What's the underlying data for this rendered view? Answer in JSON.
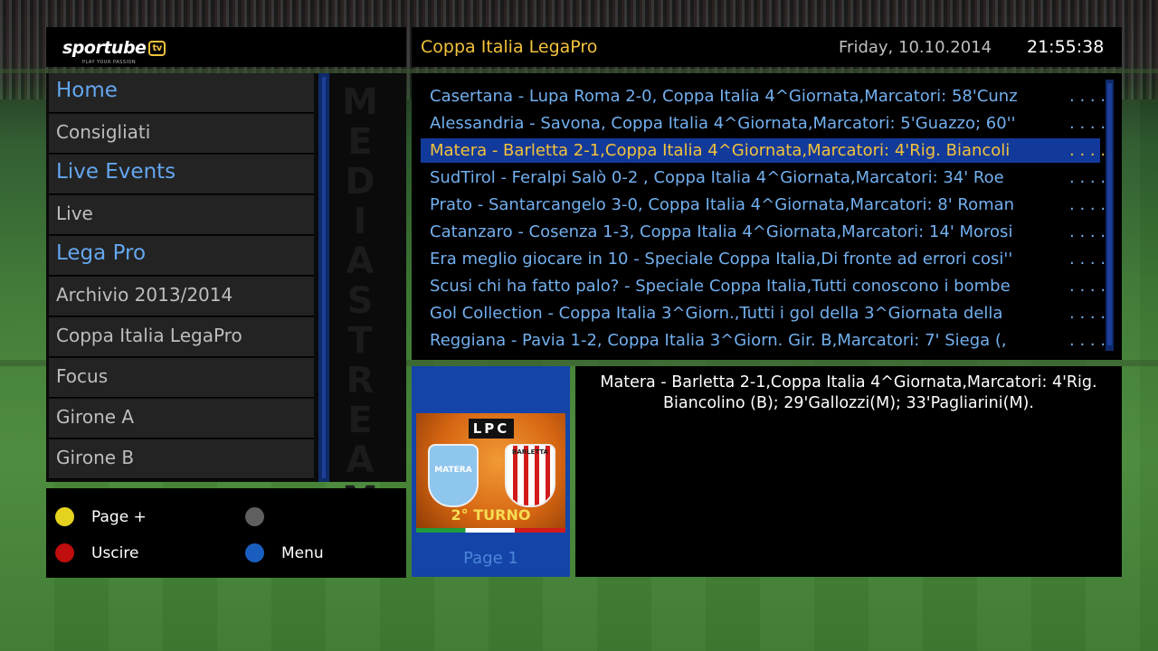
{
  "logo": {
    "brand": "sportube",
    "tv": "tv",
    "tagline": "PLAY YOUR PASSION"
  },
  "header": {
    "title": "Coppa Italia LegaPro",
    "date": "Friday, 10.10.2014",
    "time": "21:55:38"
  },
  "menu": {
    "items": [
      {
        "label": "Home",
        "category": true
      },
      {
        "label": "Consigliati",
        "category": false
      },
      {
        "label": "Live Events",
        "category": true
      },
      {
        "label": "Live",
        "category": false
      },
      {
        "label": "Lega Pro",
        "category": true
      },
      {
        "label": "Archivio 2013/2014",
        "category": false
      },
      {
        "label": "Coppa Italia LegaPro",
        "category": false
      },
      {
        "label": "Focus",
        "category": false
      },
      {
        "label": "Girone A",
        "category": false
      },
      {
        "label": "Girone B",
        "category": false
      }
    ],
    "vertical_text": "MEDIASTREAM"
  },
  "buttons": {
    "yellow": {
      "label": "Page +",
      "color": "#e4d21f"
    },
    "gray": {
      "label": "",
      "color": "#5f5f5f"
    },
    "red": {
      "label": "Uscire",
      "color": "#c00d0d"
    },
    "blue": {
      "label": "Menu",
      "color": "#1a5fbf"
    }
  },
  "list": {
    "selected_index": 2,
    "more": ". . . .",
    "rows": [
      "Casertana - Lupa Roma 2-0, Coppa Italia 4^Giornata,Marcatori: 58'Cunz",
      "Alessandria - Savona, Coppa Italia 4^Giornata,Marcatori: 5'Guazzo; 60''",
      "Matera - Barletta 2-1,Coppa Italia 4^Giornata,Marcatori: 4'Rig. Biancoli",
      "SudTirol - Feralpi Salò 0-2 , Coppa Italia 4^Giornata,Marcatori: 34' Roe",
      "Prato - Santarcangelo 3-0, Coppa Italia 4^Giornata,Marcatori: 8' Roman",
      "Catanzaro - Cosenza 1-3, Coppa Italia 4^Giornata,Marcatori: 14' Morosi",
      "Era meglio giocare in 10 - Speciale Coppa Italia,Di fronte ad errori cosi''",
      "Scusi chi ha fatto palo? - Speciale Coppa Italia,Tutti conoscono i bombe",
      "Gol Collection - Coppa Italia 3^Giorn.,Tutti i gol della 3^Giornata della",
      "Reggiana - Pavia 1-2, Coppa Italia 3^Giorn. Gir. B,Marcatori: 7' Siega (,"
    ]
  },
  "thumbnail": {
    "badge": "LPC",
    "team_a": "MATERA",
    "team_b": "BARLETTA",
    "caption": "2° TURNO"
  },
  "page_label": "Page 1",
  "description": "Matera - Barletta 2-1,Coppa Italia 4^Giornata,Marcatori: 4'Rig. Biancolino (B); 29'Gallozzi(M); 33'Pagliarini(M)."
}
